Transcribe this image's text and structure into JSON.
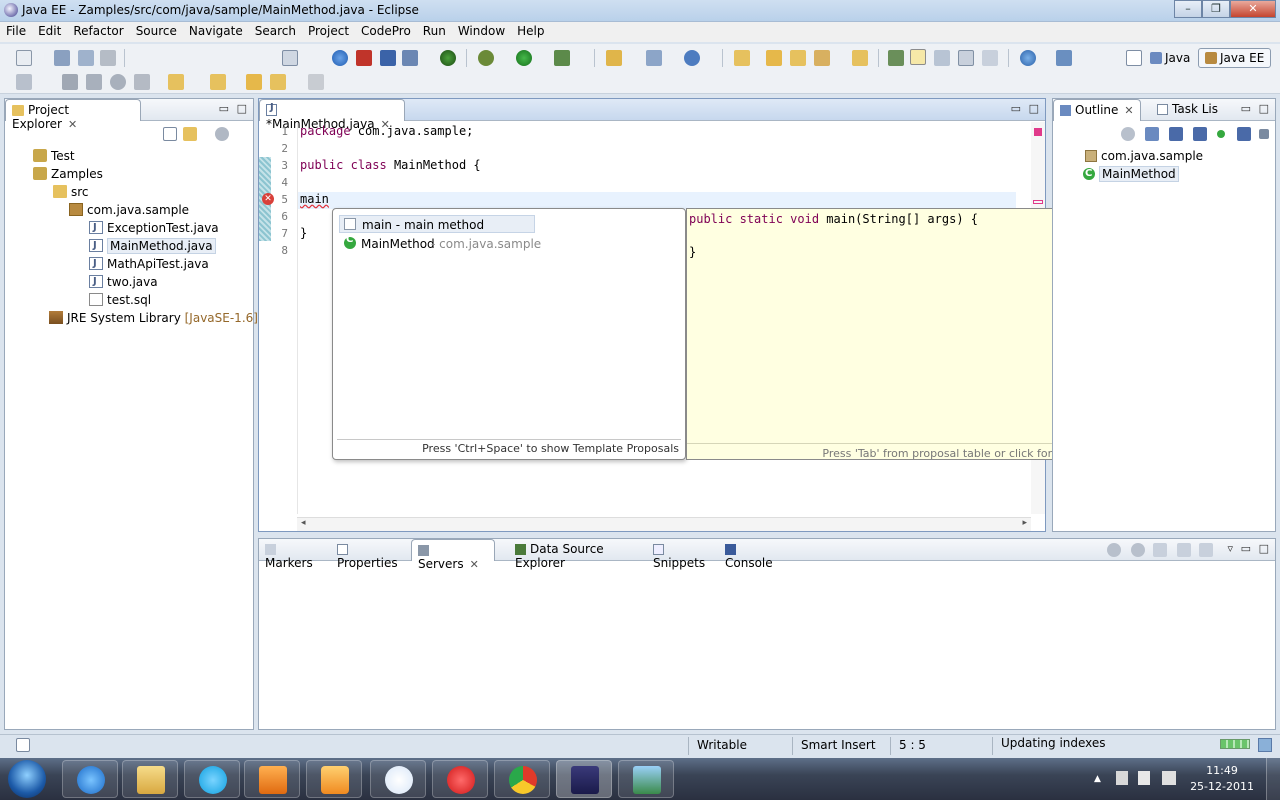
{
  "window": {
    "title": "Java EE - Zamples/src/com/java/sample/MainMethod.java - Eclipse",
    "controls": [
      "–",
      "❐",
      "✕"
    ]
  },
  "menubar": {
    "items": [
      "File",
      "Edit",
      "Refactor",
      "Source",
      "Navigate",
      "Search",
      "Project",
      "CodePro",
      "Run",
      "Window",
      "Help"
    ]
  },
  "perspectives": {
    "java": "Java",
    "java_ee": "Java EE"
  },
  "project_explorer": {
    "tab_label": "Project Explorer",
    "tree": [
      {
        "label": "Test",
        "icon": "project-icon"
      },
      {
        "label": "Zamples",
        "icon": "project-icon"
      },
      {
        "label": "src",
        "icon": "source-folder-icon"
      },
      {
        "label": "com.java.sample",
        "icon": "package-icon"
      },
      {
        "label": "ExceptionTest.java",
        "icon": "java-file-icon"
      },
      {
        "label": "MainMethod.java",
        "icon": "java-file-icon"
      },
      {
        "label": "MathApiTest.java",
        "icon": "java-file-icon"
      },
      {
        "label": "two.java",
        "icon": "java-file-icon"
      },
      {
        "label": "test.sql",
        "icon": "sql-file-icon"
      },
      {
        "label": "JRE System Library",
        "icon": "library-icon",
        "suffix": "[JavaSE-1.6]"
      }
    ]
  },
  "editor": {
    "tab_label": "*MainMethod.java",
    "line_numbers": [
      "1",
      "2",
      "3",
      "4",
      "5",
      "6",
      "7",
      "8"
    ],
    "lines": {
      "l1_kw": "package",
      "l1_rest": " com.java.sample;",
      "l3_kw1": "public",
      "l3_kw2": "class",
      "l3_rest": " MainMethod {",
      "l5": "main",
      "l7": "}"
    }
  },
  "completion": {
    "items": [
      {
        "label": "main - main method",
        "detail": ""
      },
      {
        "label": "MainMethod",
        "detail": " - com.java.sample"
      }
    ],
    "footer": "Press 'Ctrl+Space' to show Template Proposals"
  },
  "javadoc": {
    "line1_kw": "public static void",
    "line1_rest": " main(String[] args) {",
    "line2": "}",
    "footer": "Press 'Tab' from proposal table or click for focus"
  },
  "outline": {
    "tab_outline": "Outline",
    "tab_tasks": "Task Lis",
    "items": [
      {
        "label": "com.java.sample"
      },
      {
        "label": "MainMethod"
      }
    ]
  },
  "bottom_panel": {
    "tabs": [
      "Markers",
      "Properties",
      "Servers",
      "Data Source Explorer",
      "Snippets",
      "Console"
    ]
  },
  "status": {
    "writable": "Writable",
    "insert_mode": "Smart Insert",
    "position": "5 : 5",
    "task": "Updating indexes"
  },
  "taskbar": {
    "time": "11:49",
    "date": "25-12-2011",
    "apps": [
      "internet-explorer",
      "file-explorer",
      "skype",
      "vlc",
      "media-player",
      "google-talk",
      "airtel",
      "chrome",
      "eclipse-java-ee",
      "picture-viewer"
    ]
  },
  "colors": {
    "keyword": "#7f0055",
    "javadoc_bg": "#ffffe1",
    "selection": "#e8eef6"
  }
}
